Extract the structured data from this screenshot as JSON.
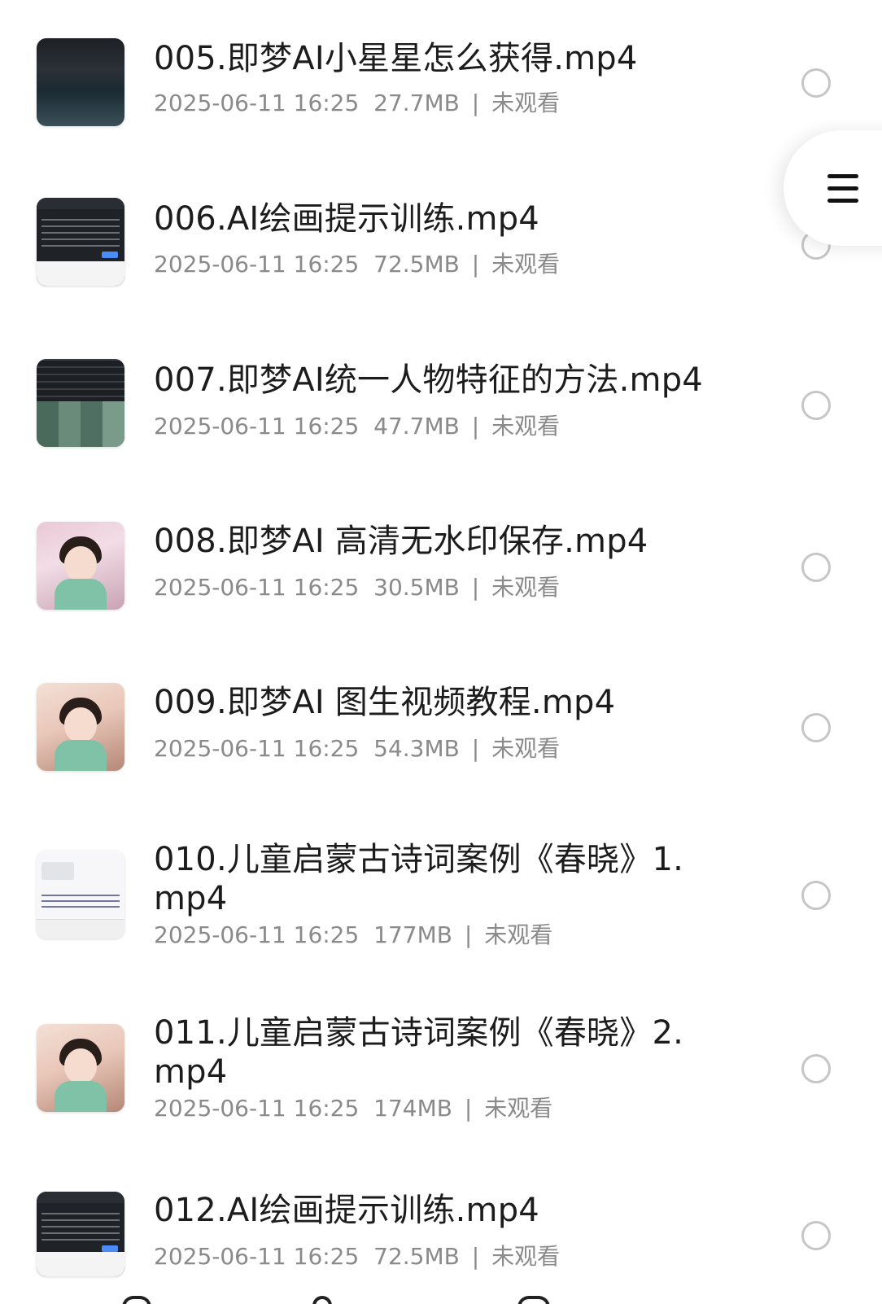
{
  "files": [
    {
      "title": "005.即梦AI小星星怎么获得.mp4",
      "date": "2025-06-11 16:25",
      "size": "27.7MB",
      "status": "未观看",
      "thumb": "dark-scene"
    },
    {
      "title": "006.AI绘画提示训练.mp4",
      "date": "2025-06-11 16:25",
      "size": "72.5MB",
      "status": "未观看",
      "thumb": "ui-screen"
    },
    {
      "title": "007.即梦AI统一人物特征的方法.mp4",
      "date": "2025-06-11 16:25",
      "size": "47.7MB",
      "status": "未观看",
      "thumb": "grid-screen"
    },
    {
      "title": "008.即梦AI 高清无水印保存.mp4",
      "date": "2025-06-11 16:25",
      "size": "30.5MB",
      "status": "未观看",
      "thumb": "pink-girl"
    },
    {
      "title": "009.即梦AI 图生视频教程.mp4",
      "date": "2025-06-11 16:25",
      "size": "54.3MB",
      "status": "未观看",
      "thumb": "warm-girl"
    },
    {
      "title": "010.儿童启蒙古诗词案例《春晓》1.mp4",
      "date": "2025-06-11 16:25",
      "size": "177MB",
      "status": "未观看",
      "thumb": "light-screen"
    },
    {
      "title": "011.儿童启蒙古诗词案例《春晓》2.mp4",
      "date": "2025-06-11 16:25",
      "size": "174MB",
      "status": "未观看",
      "thumb": "warm-girl"
    },
    {
      "title": "012.AI绘画提示训练.mp4",
      "date": "2025-06-11 16:25",
      "size": "72.5MB",
      "status": "未观看",
      "thumb": "ui-screen"
    }
  ],
  "separator": "|",
  "menu": {
    "icon": "menu-icon"
  },
  "colors": {
    "title": "#1c1c1c",
    "meta": "#8a8a8a",
    "radio_border": "#c6c6c6",
    "background": "#ffffff"
  }
}
